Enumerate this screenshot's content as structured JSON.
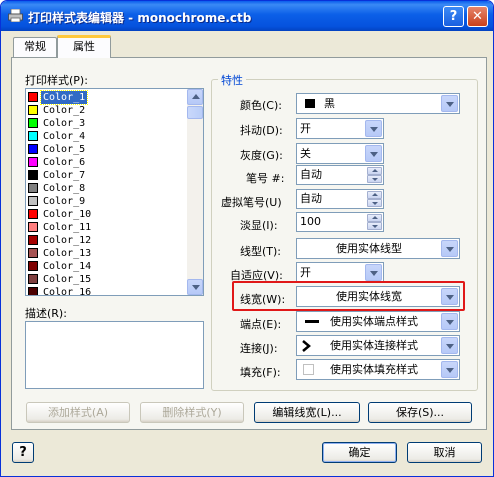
{
  "window": {
    "title": "打印样式表编辑器 - monochrome.ctb",
    "help_label": "?",
    "close_label": "✕"
  },
  "tabs": [
    {
      "label": "常规",
      "active": false
    },
    {
      "label": "属性",
      "active": true
    }
  ],
  "styles_panel": {
    "label": "打印样式(P):",
    "items": [
      {
        "name": "Color_1",
        "color": "#ff0000",
        "selected": true
      },
      {
        "name": "Color_2",
        "color": "#ffff00"
      },
      {
        "name": "Color_3",
        "color": "#00ff00"
      },
      {
        "name": "Color_4",
        "color": "#00ffff"
      },
      {
        "name": "Color_5",
        "color": "#0000ff"
      },
      {
        "name": "Color_6",
        "color": "#ff00ff"
      },
      {
        "name": "Color_7",
        "color": "#000000"
      },
      {
        "name": "Color_8",
        "color": "#808080"
      },
      {
        "name": "Color_9",
        "color": "#c0c0c0"
      },
      {
        "name": "Color_10",
        "color": "#ff0000"
      },
      {
        "name": "Color_11",
        "color": "#ff7f7f"
      },
      {
        "name": "Color_12",
        "color": "#a50000"
      },
      {
        "name": "Color_13",
        "color": "#a55252"
      },
      {
        "name": "Color_14",
        "color": "#7f0000"
      },
      {
        "name": "Color_15",
        "color": "#7f3f3f"
      },
      {
        "name": "Color_16",
        "color": "#4c0000"
      }
    ],
    "description_label": "描述(R):"
  },
  "properties": {
    "group_title": "特性",
    "color_label": "颜色(C):",
    "color_value": "黑",
    "color_swatch": "#000000",
    "dither_label": "抖动(D):",
    "dither_value": "开",
    "grayscale_label": "灰度(G):",
    "grayscale_value": "关",
    "pen_label": "笔号 #:",
    "pen_value": "自动",
    "virtual_pen_label": "虚拟笔号(U)",
    "virtual_pen_value": "自动",
    "screening_label": "淡显(I):",
    "screening_value": "100",
    "linetype_label": "线型(T):",
    "linetype_value": "使用实体线型",
    "adaptive_label": "自适应(V):",
    "adaptive_value": "开",
    "lineweight_label": "线宽(W):",
    "lineweight_value": "使用实体线宽",
    "endstyle_label": "端点(E):",
    "endstyle_value": "使用实体端点样式",
    "joinstyle_label": "连接(J):",
    "joinstyle_value": "使用实体连接样式",
    "fillstyle_label": "填充(F):",
    "fillstyle_value": "使用实体填充样式"
  },
  "buttons": {
    "add_style": "添加样式(A)",
    "delete_style": "删除样式(Y)",
    "edit_lineweights": "编辑线宽(L)...",
    "save_as": "保存(S)...",
    "ok": "确定",
    "cancel": "取消",
    "help": "?"
  },
  "colors": {
    "highlight": "#e01818",
    "selection": "#316ac5",
    "group_title": "#0046d5"
  }
}
